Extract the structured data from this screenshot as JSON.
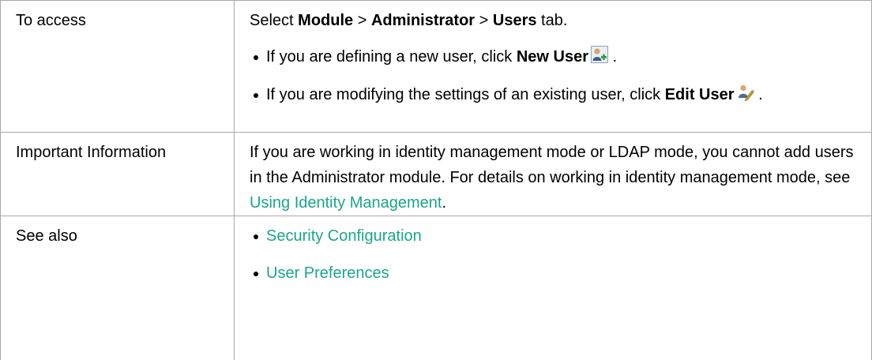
{
  "rows": {
    "access": {
      "label": "To access",
      "path": {
        "prefix": "Select ",
        "module": "Module",
        "sep1": " > ",
        "administrator": "Administrator",
        "sep2": " > ",
        "users": "Users",
        "suffix": " tab."
      },
      "bullets": [
        {
          "text": "If you are defining a new user, click ",
          "bold": "New User",
          "icon": "new-user-icon",
          "after": " ."
        },
        {
          "text": "If you are modifying the settings of an existing user, click ",
          "bold": "Edit User",
          "icon": "edit-user-icon",
          "after": " ."
        }
      ]
    },
    "important": {
      "label": "Important Information",
      "text": "If you are working in identity management mode or LDAP mode, you cannot add users in the Administrator module. For details on working in identity management mode, see ",
      "link": "Using Identity Management",
      "after": "."
    },
    "see_also": {
      "label": "See also",
      "links": [
        "Security Configuration",
        "User Preferences"
      ]
    }
  },
  "colors": {
    "link": "#1aa58d",
    "border": "#a9a9a9",
    "text": "#000000"
  }
}
